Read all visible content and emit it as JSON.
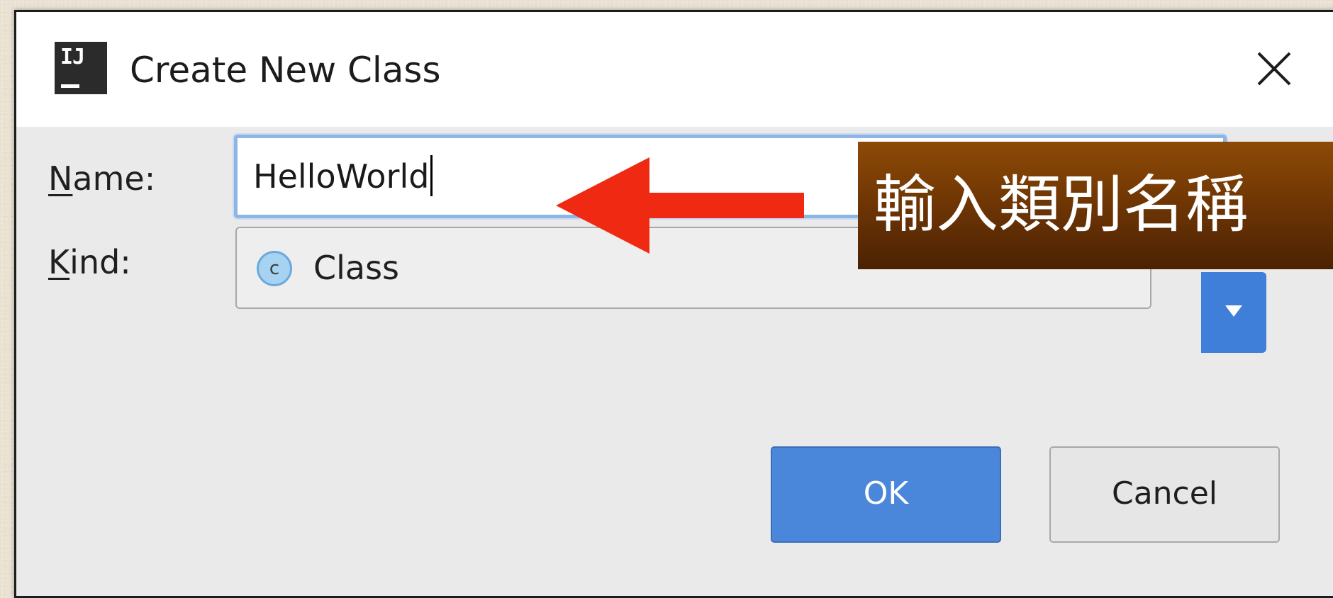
{
  "dialog": {
    "title": "Create New Class",
    "app_icon_text": "IJ"
  },
  "form": {
    "name_label_mnemonic": "N",
    "name_label_rest": "ame:",
    "name_value": "HelloWorld",
    "kind_label_mnemonic": "K",
    "kind_label_rest": "ind:",
    "kind_icon_letter": "c",
    "kind_value": "Class"
  },
  "buttons": {
    "ok_label": "OK",
    "cancel_label": "Cancel"
  },
  "annotation": {
    "text": "輸入類別名稱"
  },
  "icons": {
    "close": "close-icon",
    "app": "intellij-icon",
    "class_kind": "class-icon",
    "dropdown": "chevron-down-icon",
    "arrow": "arrow-left-icon"
  },
  "colors": {
    "accent_blue": "#4a86d9",
    "annotation_brown": "#6a3304",
    "arrow_red": "#f02a12"
  }
}
